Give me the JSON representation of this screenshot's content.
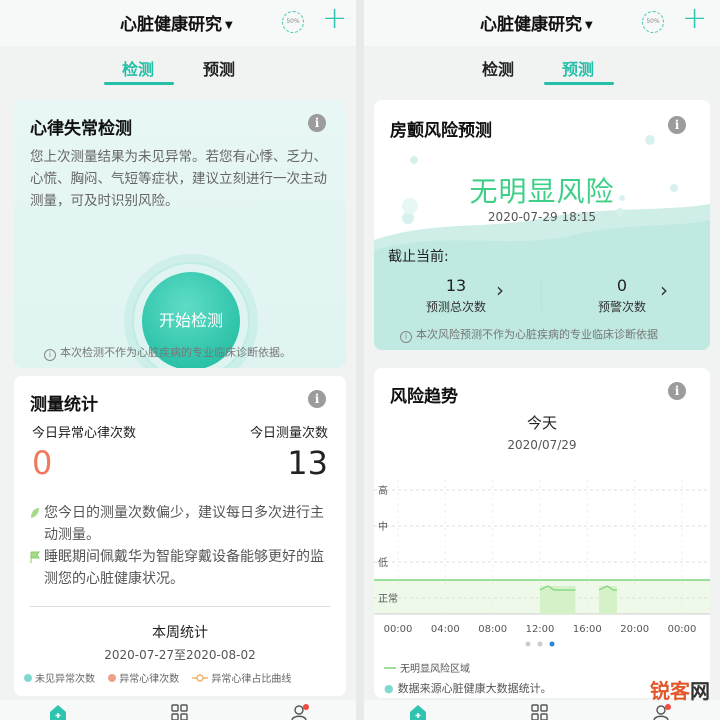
{
  "left": {
    "header": {
      "title": "心脏健康研究",
      "badge": "50%"
    },
    "tabs": [
      {
        "label": "检测",
        "active": true
      },
      {
        "label": "预测",
        "active": false
      }
    ],
    "arrhythmia_card": {
      "title": "心律失常检测",
      "description": "您上次测量结果为未见异常。若您有心悸、乏力、心慌、胸闷、气短等症状，建议立刻进行一次主动测量，可及时识别风险。",
      "button": "开始检测",
      "disclaimer": "本次检测不作为心脏疾病的专业临床诊断依据。"
    },
    "stats_card": {
      "title": "测量统计",
      "abnormal_label": "今日异常心律次数",
      "abnormal_value": "0",
      "count_label": "今日测量次数",
      "count_value": "13",
      "tip1": "您今日的测量次数偏少，建议每日多次进行主动测量。",
      "tip2": "睡眠期间佩戴华为智能穿戴设备能够更好的监测您的心脏健康状况。",
      "week_title": "本周统计",
      "week_range": "2020-07-27至2020-08-02",
      "legend": [
        {
          "label": "未见异常次数",
          "color": "#7fd9d0"
        },
        {
          "label": "异常心律次数",
          "color": "#f0a08a"
        },
        {
          "label": "异常心律占比曲线",
          "color": "#f5b26b"
        }
      ]
    }
  },
  "right": {
    "header": {
      "title": "心脏健康研究",
      "badge": "50%"
    },
    "tabs": [
      {
        "label": "检测",
        "active": false
      },
      {
        "label": "预测",
        "active": true
      }
    ],
    "afib_card": {
      "title": "房颤风险预测",
      "status": "无明显风险",
      "datetime": "2020-07-29 18:15",
      "as_of": "截止当前:",
      "total_value": "13",
      "total_label": "预测总次数",
      "warning_value": "0",
      "warning_label": "预警次数",
      "disclaimer": "本次风险预测不作为心脏疾病的专业临床诊断依据"
    },
    "trend_card": {
      "title": "风险趋势",
      "today": "今天",
      "date": "2020/07/29",
      "legend": "无明显风险区域",
      "source": "数据来源心脏健康大数据统计。"
    }
  },
  "chart_data": {
    "type": "area",
    "title": "风险趋势",
    "y_levels": [
      "高",
      "中",
      "低",
      "正常"
    ],
    "x_ticks": [
      "00:00",
      "04:00",
      "08:00",
      "12:00",
      "16:00",
      "20:00",
      "00:00"
    ],
    "series": [
      {
        "name": "无明显风险区域",
        "segments": [
          {
            "start": "12:00",
            "end": "15:00",
            "level": "正常"
          },
          {
            "start": "17:00",
            "end": "18:30",
            "level": "正常"
          }
        ]
      }
    ],
    "colors": {
      "area": "#d4f1c8",
      "line": "#7ad67a"
    }
  },
  "watermark": {
    "brand": "锐客",
    "suffix": "网"
  }
}
